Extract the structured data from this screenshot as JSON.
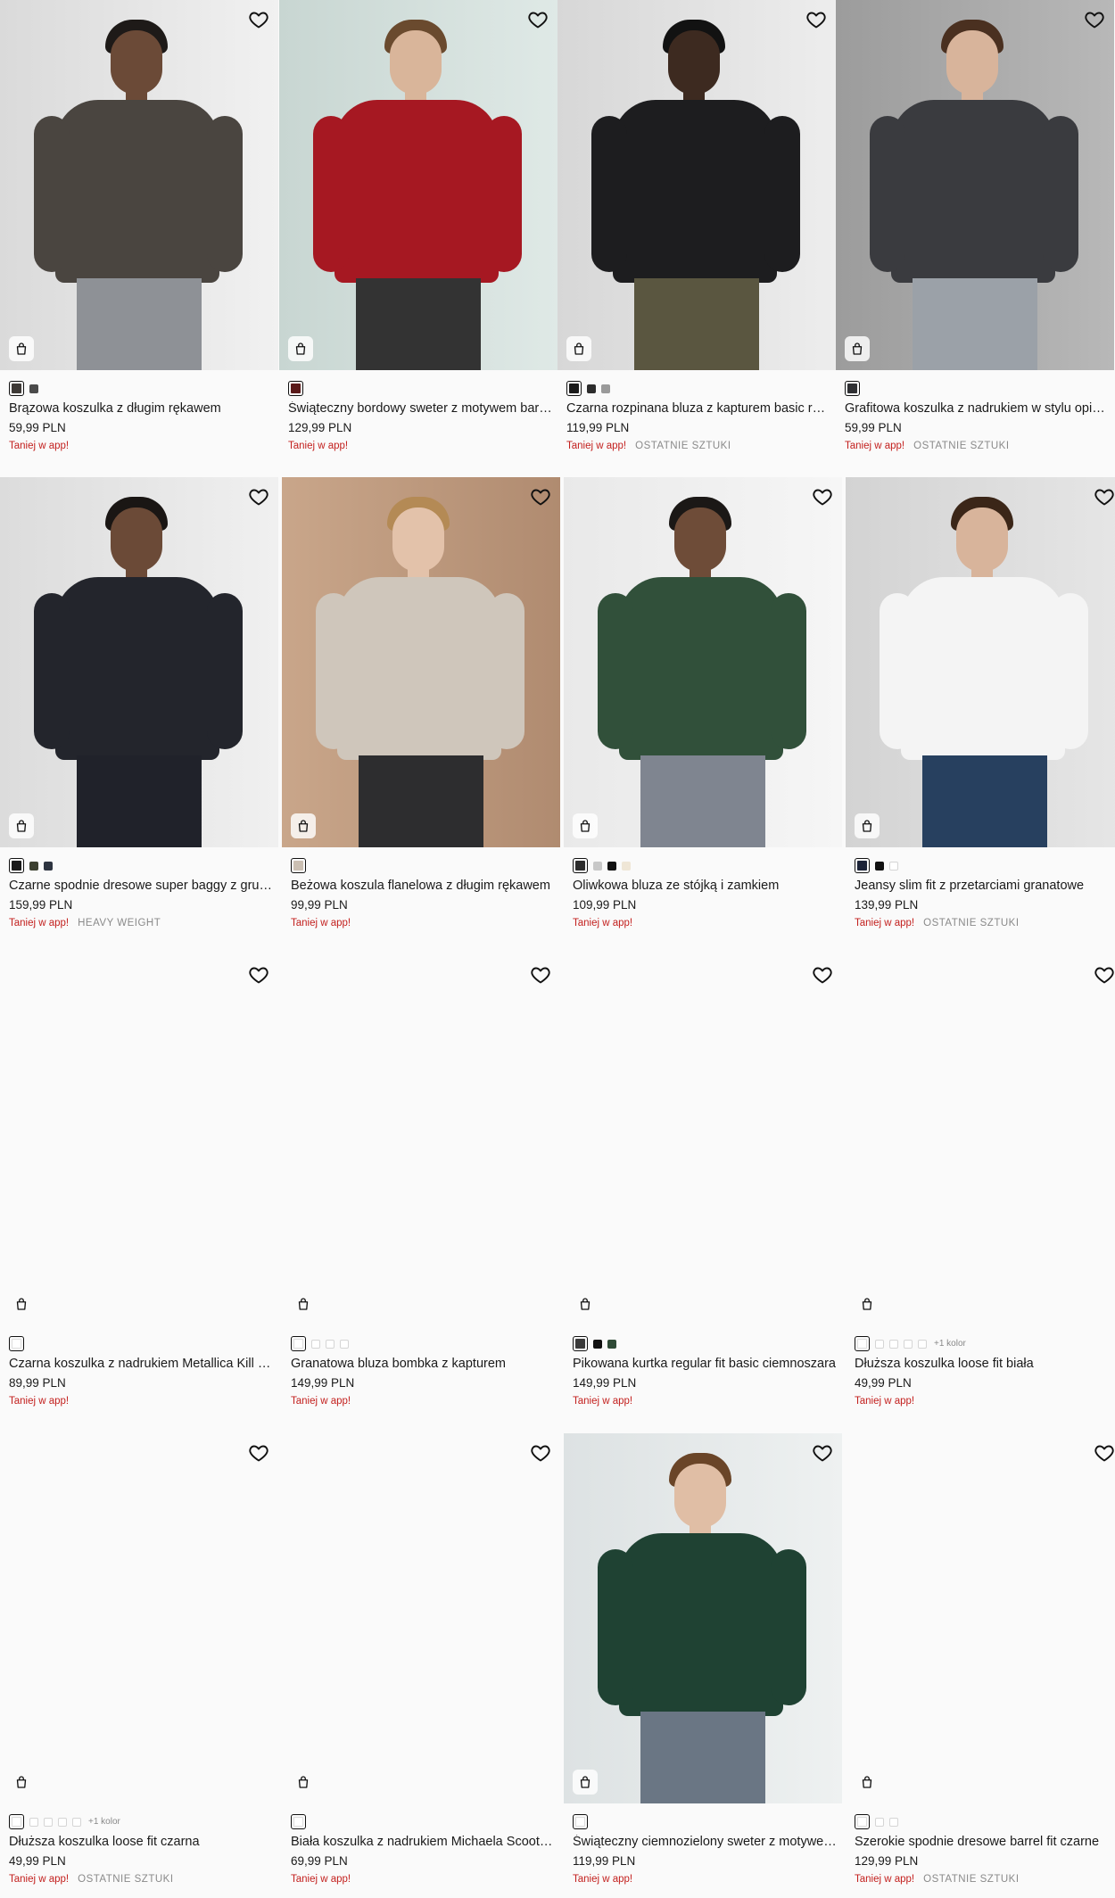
{
  "colors": {
    "promo": "#c3201e",
    "badge": "#8a8a8a",
    "text": "#1a1a1a",
    "background": "#fafafa"
  },
  "icons": {
    "wishlist": "heart-icon",
    "quick_add": "shopping-bag-icon"
  },
  "products": [
    {
      "name": "Brązowa koszulka z długim rękawem",
      "price": "59,99 PLN",
      "promo": "Taniej w app!",
      "badge": "",
      "swatches": [
        "#3e3a37",
        "#4a4a4a"
      ],
      "more_colors": ""
    },
    {
      "name": "Świąteczny bordowy sweter z motywem barszczu",
      "price": "129,99 PLN",
      "promo": "Taniej w app!",
      "badge": "",
      "swatches": [
        "#5a1a1a"
      ],
      "more_colors": ""
    },
    {
      "name": "Czarna rozpinana bluza z kapturem basic regular fit",
      "price": "119,99 PLN",
      "promo": "Taniej w app!",
      "badge": "OSTATNIE SZTUKI",
      "swatches": [
        "#1a1a1a",
        "#2c2c2c",
        "#9a9a9a"
      ],
      "more_colors": ""
    },
    {
      "name": "Grafitowa koszulka z nadrukiem w stylu opium core",
      "price": "59,99 PLN",
      "promo": "Taniej w app!",
      "badge": "OSTATNIE SZTUKI",
      "swatches": [
        "#2f3033"
      ],
      "more_colors": ""
    },
    {
      "name": "Czarne spodnie dresowe super baggy z grubej dzianiny",
      "price": "159,99 PLN",
      "promo": "Taniej w app!",
      "badge": "HEAVY WEIGHT",
      "swatches": [
        "#1a1a1a",
        "#3c4030",
        "#2d3440"
      ],
      "more_colors": ""
    },
    {
      "name": "Beżowa koszula flanelowa z długim rękawem",
      "price": "99,99 PLN",
      "promo": "Taniej w app!",
      "badge": "",
      "swatches": [
        "#cbbfb2"
      ],
      "more_colors": ""
    },
    {
      "name": "Oliwkowa bluza ze stójką i zamkiem",
      "price": "109,99 PLN",
      "promo": "Taniej w app!",
      "badge": "",
      "swatches": [
        "#2c2c2c",
        "#c8c8c8",
        "#111111",
        "#efe6d6"
      ],
      "more_colors": ""
    },
    {
      "name": "Jeansy slim fit z przetarciami granatowe",
      "price": "139,99 PLN",
      "promo": "Taniej w app!",
      "badge": "OSTATNIE SZTUKI",
      "swatches": [
        "#1c2338",
        "#111111",
        "#ffffff"
      ],
      "more_colors": ""
    },
    {
      "name": "Czarna koszulka z nadrukiem Metallica Kill 'Em All",
      "price": "89,99 PLN",
      "promo": "Taniej w app!",
      "badge": "",
      "swatches": [
        "#ffffff"
      ],
      "more_colors": ""
    },
    {
      "name": "Granatowa bluza bombka z kapturem",
      "price": "149,99 PLN",
      "promo": "Taniej w app!",
      "badge": "",
      "swatches": [
        "#ffffff",
        "#ffffff",
        "#ffffff",
        "#ffffff"
      ],
      "more_colors": ""
    },
    {
      "name": "Pikowana kurtka regular fit basic ciemnoszara",
      "price": "149,99 PLN",
      "promo": "Taniej w app!",
      "badge": "",
      "swatches": [
        "#3a3a3a",
        "#111111",
        "#2f4a36"
      ],
      "more_colors": ""
    },
    {
      "name": "Dłuższa koszulka loose fit biała",
      "price": "49,99 PLN",
      "promo": "Taniej w app!",
      "badge": "",
      "swatches": [
        "#ffffff",
        "#ffffff",
        "#ffffff",
        "#ffffff",
        "#ffffff"
      ],
      "more_colors": "+1 kolor"
    },
    {
      "name": "Dłuższa koszulka loose fit czarna",
      "price": "49,99 PLN",
      "promo": "Taniej w app!",
      "badge": "OSTATNIE SZTUKI",
      "swatches": [
        "#ffffff",
        "#ffffff",
        "#ffffff",
        "#ffffff",
        "#ffffff"
      ],
      "more_colors": "+1 kolor"
    },
    {
      "name": "Biała koszulka z nadrukiem Michaela Scoota The Office",
      "price": "69,99 PLN",
      "promo": "Taniej w app!",
      "badge": "",
      "swatches": [
        "#ffffff"
      ],
      "more_colors": ""
    },
    {
      "name": "Świąteczny ciemnozielony sweter z motywem Grincha",
      "price": "119,99 PLN",
      "promo": "Taniej w app!",
      "badge": "",
      "swatches": [
        "#ffffff"
      ],
      "more_colors": ""
    },
    {
      "name": "Szerokie spodnie dresowe barrel fit czarne",
      "price": "129,99 PLN",
      "promo": "Taniej w app!",
      "badge": "OSTATNIE SZTUKI",
      "swatches": [
        "#ffffff",
        "#ffffff",
        "#ffffff"
      ],
      "more_colors": ""
    }
  ]
}
